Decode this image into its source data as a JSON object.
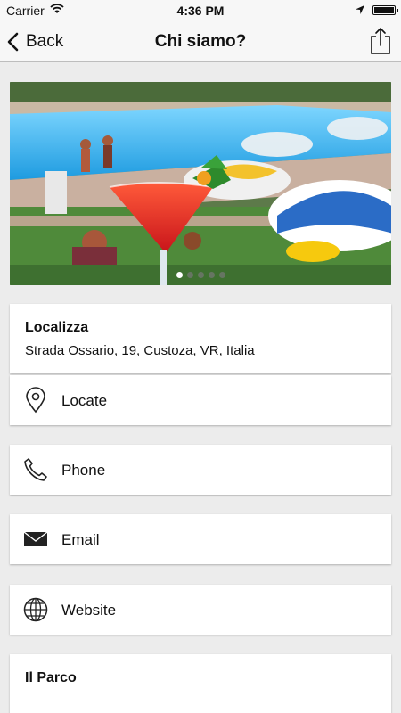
{
  "status_bar": {
    "carrier": "Carrier",
    "time": "4:36 PM"
  },
  "nav": {
    "back_label": "Back",
    "title": "Chi siamo?"
  },
  "gallery": {
    "total_dots": 5,
    "active_index": 0
  },
  "location_card": {
    "title": "Localizza",
    "address": "Strada Ossario, 19, Custoza, VR, Italia"
  },
  "actions": [
    {
      "label": "Locate",
      "icon": "map-pin-icon"
    },
    {
      "label": "Phone",
      "icon": "phone-icon"
    },
    {
      "label": "Email",
      "icon": "envelope-icon"
    },
    {
      "label": "Website",
      "icon": "globe-icon"
    }
  ],
  "park_card": {
    "title": "Il Parco"
  }
}
